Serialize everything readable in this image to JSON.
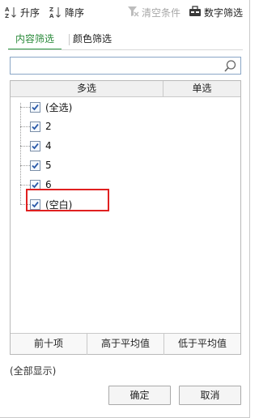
{
  "toolbar": {
    "asc_label": "升序",
    "desc_label": "降序",
    "clear_label": "清空条件",
    "numfilter_label": "数字筛选"
  },
  "tabs": [
    {
      "label": "内容筛选",
      "active": true
    },
    {
      "label": "颜色筛选",
      "active": false
    }
  ],
  "search": {
    "value": "",
    "placeholder": ""
  },
  "list": {
    "headers": {
      "multi": "多选",
      "single": "单选"
    },
    "items": [
      {
        "label": "(全选)",
        "checked": true
      },
      {
        "label": "2",
        "checked": true
      },
      {
        "label": "4",
        "checked": true
      },
      {
        "label": "5",
        "checked": true
      },
      {
        "label": "6",
        "checked": true
      },
      {
        "label": "(空白)",
        "checked": true,
        "highlighted": true
      }
    ],
    "footer": {
      "top10": "前十项",
      "above_avg": "高于平均值",
      "below_avg": "低于平均值"
    }
  },
  "status": "(全部显示)",
  "dialog": {
    "ok": "确定",
    "cancel": "取消"
  },
  "colors": {
    "accent": "#2e9a45",
    "highlight": "#e02020",
    "check": "#2b5aa8"
  }
}
